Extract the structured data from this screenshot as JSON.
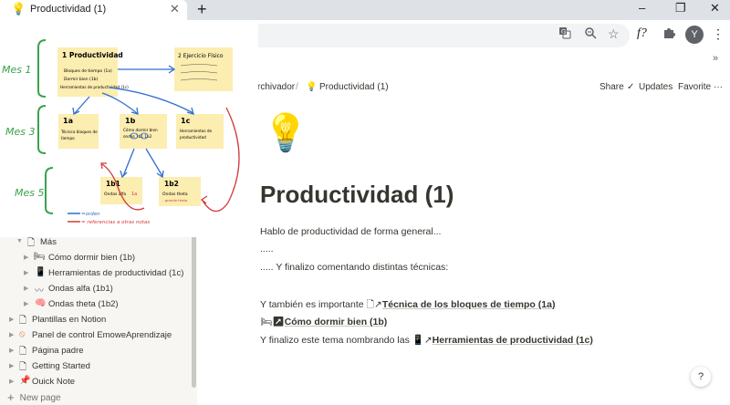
{
  "browser": {
    "tab_title": "Productividad (1)",
    "tab_icon": "lightbulb-icon",
    "new_tab_symbol": "+",
    "window_controls": [
      "–",
      "❐",
      "✕"
    ],
    "profile_initial": "Y",
    "bookmarks_overflow": "»",
    "toolbar_icons": [
      "translate-icon",
      "zoom-icon",
      "star-icon",
      "function-extension-icon",
      "puzzle-icon",
      "profile-icon",
      "menu-icon"
    ]
  },
  "topbar": {
    "breadcrumb_parent": "rchivador",
    "separator": "/",
    "breadcrumb_current": "Productividad (1)",
    "share": "Share",
    "updates": "Updates",
    "favorite": "Favorite",
    "more": "···"
  },
  "sidebar": {
    "items": [
      {
        "label": "Más",
        "icon": "page-icon",
        "level": 1
      },
      {
        "label": "Cómo dormir bien (1b)",
        "icon": "bed-icon",
        "level": 2
      },
      {
        "label": "Herramientas de productividad (1c)",
        "icon": "phone-icon",
        "level": 2
      },
      {
        "label": "Ondas alfa (1b1)",
        "icon": "wave-icon",
        "level": 2
      },
      {
        "label": "Ondas theta (1b2)",
        "icon": "brain-icon",
        "level": 2
      },
      {
        "label": "Plantillas en Notion",
        "icon": "page-icon",
        "level": 0
      },
      {
        "label": "Panel de control EmoweAprendizaje",
        "icon": "no-entry-icon",
        "level": 0
      },
      {
        "label": "Página padre",
        "icon": "page-icon",
        "level": 0
      },
      {
        "label": "Getting Started",
        "icon": "page-icon",
        "level": 0
      },
      {
        "label": "Quick Note",
        "icon": "pin-icon",
        "level": 0
      }
    ],
    "new_page": "New page"
  },
  "sketch": {
    "months": [
      "Mes 1",
      "Mes 3",
      "Mes 5"
    ],
    "notes": {
      "n1": "1 Productividad",
      "n1_lines": [
        "Bloques de tiempo (1a)",
        "Dormir bien (1b)",
        "Herramientas de productividad (1c)"
      ],
      "n2": "2 Ejercicio Físico",
      "n1a": "1a",
      "n1a_lines": [
        "Técnica bloques de",
        "tiempo"
      ],
      "n1b": "1b",
      "n1b_lines": [
        "Cómo dormir bien",
        "ondas 1b1 1b2"
      ],
      "n1c": "1c",
      "n1c_lines": [
        "Herramientas de",
        "productividad"
      ],
      "n1b1": "1b1",
      "n1b1_lines": [
        "Ondas alfa",
        "1a"
      ],
      "n1b2": "1b2",
      "n1b2_lines": [
        "Ondas theta",
        "- grande theta"
      ]
    },
    "legend_blue": "=orden",
    "legend_red": "= referencias a otras notas"
  },
  "page": {
    "icon": "lightbulb-icon",
    "title": "Productividad (1)",
    "p1": "Hablo de productividad de forma general...",
    "p2": ".....",
    "p3": "..... Y finalizo comentando distintas técnicas:",
    "line1_prefix": "Y también es importante",
    "line1_ref": "Técnica de los bloques de tiempo (1a)",
    "line2_ref": "Cómo dormir bien (1b)",
    "line3_prefix": "Y finalizo este tema nombrando las",
    "line3_ref": "Herramientas de productividad (1c)",
    "help": "?"
  }
}
